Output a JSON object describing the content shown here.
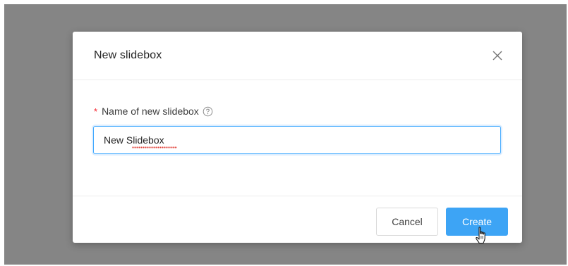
{
  "dialog": {
    "title": "New slidebox",
    "close_icon": "close-icon"
  },
  "form": {
    "required_mark": "*",
    "label": "Name of new slidebox",
    "help_icon": "question-circle-icon",
    "name_value": "New Slidebox"
  },
  "footer": {
    "cancel_label": "Cancel",
    "create_label": "Create"
  },
  "colors": {
    "primary": "#3da4f5",
    "required": "#f5222d",
    "backdrop": "#858585"
  },
  "cursor": "hand-pointer-icon"
}
